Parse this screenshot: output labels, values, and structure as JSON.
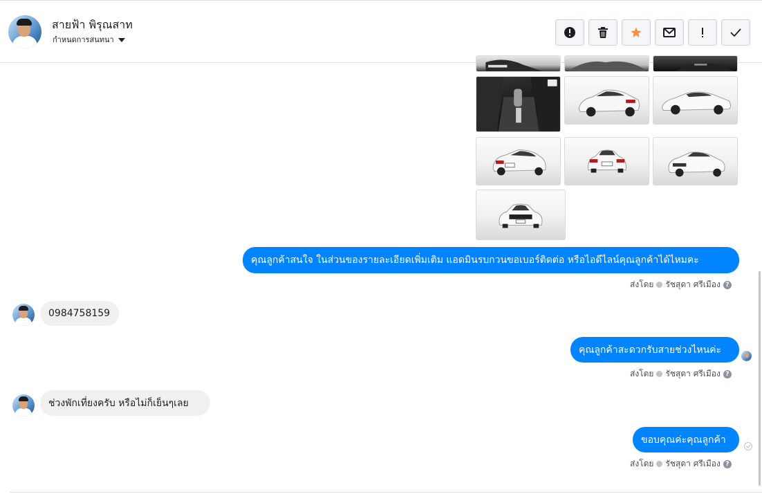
{
  "contact": {
    "name": "สายฟ้า พิรุณสาท",
    "subtitle": "กำหนดการสนทนา"
  },
  "toolbar": {
    "buttons": [
      {
        "icon": "alert-circle-icon",
        "name": "spam-button"
      },
      {
        "icon": "trash-icon",
        "name": "delete-button"
      },
      {
        "icon": "star-icon",
        "name": "star-button",
        "color": "#f7923a"
      },
      {
        "icon": "envelope-icon",
        "name": "mark-unread-button"
      },
      {
        "icon": "exclamation-icon",
        "name": "follow-up-button"
      },
      {
        "icon": "checkmark-icon",
        "name": "done-button"
      }
    ]
  },
  "messages": [
    {
      "direction": "out",
      "text": "คุณลูกค้าสนใจ ในส่วนของรายละเอียดเพิ่มเติม แอดมินรบกวนขอเบอร์ติดต่อ หรือไอดีไลน์คุณลูกค้าได้ไหมคะ",
      "sent_by_label": "ส่งโดย",
      "sender": "รัชสุดา ศรีเมือง"
    },
    {
      "direction": "in",
      "text": "0984758159"
    },
    {
      "direction": "out",
      "text": "คุณลูกค้าสะดวกรับสายช่วงไหนค่ะ",
      "sent_by_label": "ส่งโดย",
      "sender": "รัชสุดา ศรีเมือง"
    },
    {
      "direction": "in",
      "text": "ช่วงพักเที่ยงครับ หรือไม่ก็เย็นๆเลย"
    },
    {
      "direction": "out",
      "text": "ขอบคุณค่ะคุณลูกค้า",
      "sent_by_label": "ส่งโดย",
      "sender": "รัชสุดา ศรีเมือง"
    }
  ],
  "help_glyph": "?",
  "colors": {
    "outgoing_bubble": "#0084ff",
    "incoming_bubble": "#f1f0f0",
    "star": "#f7923a"
  }
}
